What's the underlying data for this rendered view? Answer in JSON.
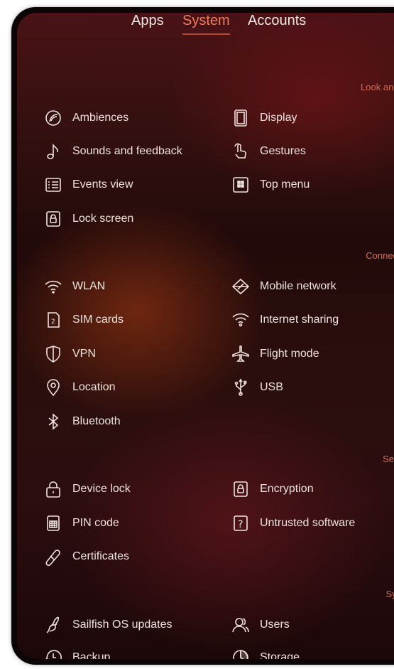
{
  "tabs": [
    "Apps",
    "System",
    "Accounts"
  ],
  "active_tab": "System",
  "sections": {
    "look_and_feel": "Look and fe",
    "connectivity": "Connectivi",
    "security": "Securi",
    "system": "Syste"
  },
  "items": {
    "ambiences": "Ambiences",
    "sounds": "Sounds and feedback",
    "events_view": "Events view",
    "lock_screen": "Lock screen",
    "display": "Display",
    "gestures": "Gestures",
    "top_menu": "Top menu",
    "wlan": "WLAN",
    "sim_cards": "SIM cards",
    "vpn": "VPN",
    "location": "Location",
    "bluetooth": "Bluetooth",
    "mobile_network": "Mobile network",
    "internet_sharing": "Internet sharing",
    "flight_mode": "Flight mode",
    "usb": "USB",
    "device_lock": "Device lock",
    "pin_code": "PIN code",
    "certificates": "Certificates",
    "encryption": "Encryption",
    "untrusted_software": "Untrusted software",
    "os_updates": "Sailfish OS updates",
    "backup": "Backup",
    "users": "Users",
    "storage": "Storage"
  },
  "sim_icon_number": "2",
  "untrusted_icon_char": "?",
  "colors": {
    "accent": "#f07d5a",
    "section": "#d16e55",
    "text": "#efe3df"
  }
}
